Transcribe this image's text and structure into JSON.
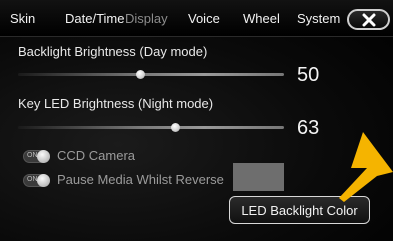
{
  "tabs": [
    {
      "label": "Skin",
      "active": true
    },
    {
      "label": "Date/Time",
      "active": true
    },
    {
      "label": "Display",
      "active": false
    },
    {
      "label": "Voice",
      "active": true
    },
    {
      "label": "Wheel",
      "active": true
    },
    {
      "label": "System",
      "active": true
    }
  ],
  "close_icon": "close-x-icon",
  "backlight": {
    "label": "Backlight Brightness (Day mode)",
    "value": "50",
    "level": 0.46
  },
  "key_led": {
    "label": "Key LED Brightness (Night mode)",
    "value": "63",
    "level": 0.59
  },
  "toggles": {
    "ccd_camera": {
      "state_text": "ON",
      "label": "CCD Camera"
    },
    "pause_media": {
      "state_text": "ON",
      "label": "Pause Media Whilst Reverse"
    }
  },
  "swatch_color": "#6e6e6e",
  "led_color_button_label": "LED Backlight Color",
  "accent_arrow_color": "#f5b400"
}
